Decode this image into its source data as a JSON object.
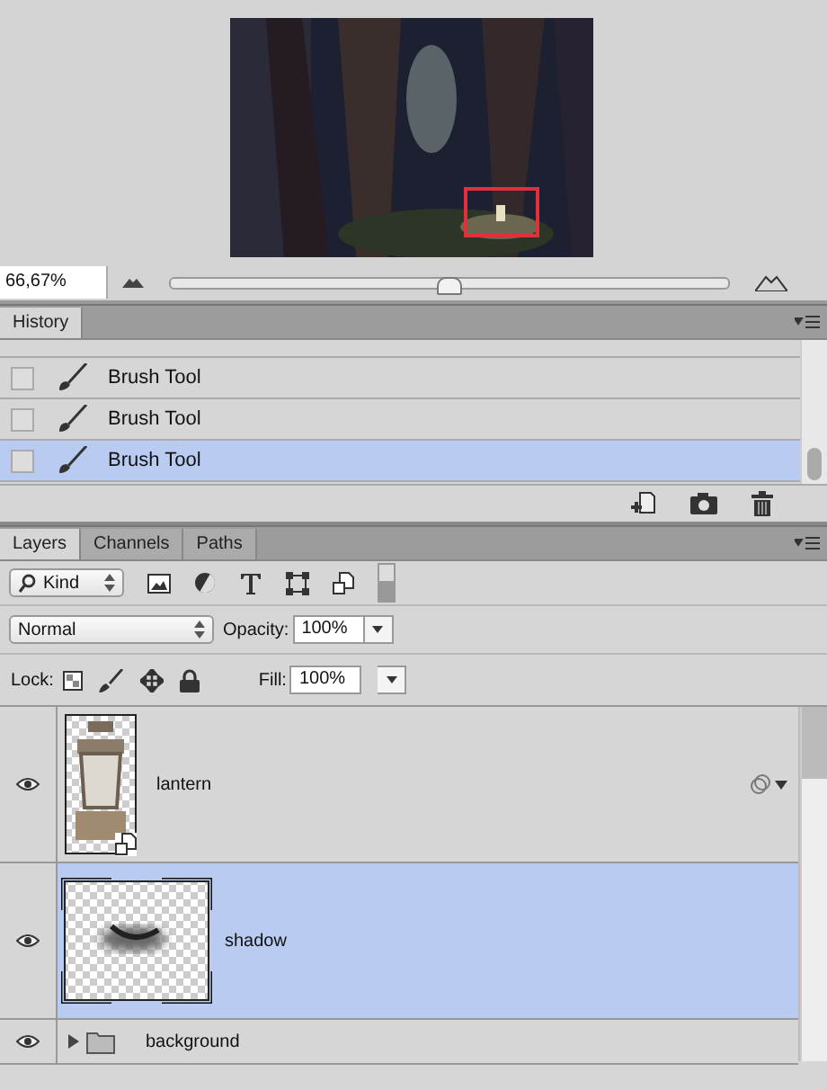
{
  "navigator": {
    "zoom": "66,67%",
    "level": 0.5
  },
  "history": {
    "tab": {
      "label": "History",
      "selected": true
    },
    "items": [
      {
        "label": "Brush Tool",
        "selected": false
      },
      {
        "label": "Brush Tool",
        "selected": false
      },
      {
        "label": "Brush Tool",
        "selected": true
      }
    ]
  },
  "layers_panel": {
    "tabs": [
      {
        "label": "Layers",
        "selected": true
      },
      {
        "label": "Channels",
        "selected": false
      },
      {
        "label": "Paths",
        "selected": false
      }
    ],
    "filter": "Kind",
    "blend_mode": "Normal",
    "opacity_label": "Opacity:",
    "opacity": "100%",
    "lock_label": "Lock:",
    "fill_label": "Fill:",
    "fill": "100%",
    "layers": [
      {
        "name": "lantern",
        "kind": "smart",
        "visible": true,
        "selected": false
      },
      {
        "name": "shadow",
        "kind": "pixel",
        "visible": true,
        "selected": true
      },
      {
        "name": "background",
        "kind": "group",
        "visible": true,
        "selected": false
      }
    ]
  }
}
